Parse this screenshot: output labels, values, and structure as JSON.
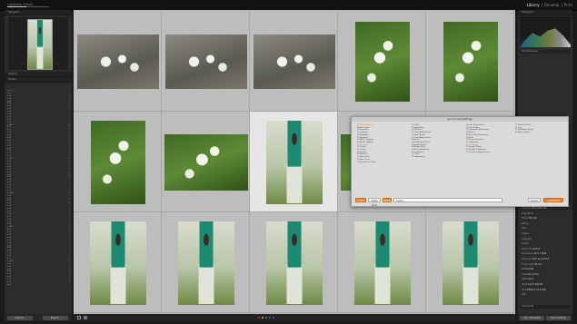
{
  "app": {
    "identity": "Lightroom Classic",
    "progress_fraction": 0.45,
    "modules": [
      "Library",
      "Develop",
      "Print"
    ],
    "active_module": "Library",
    "accent": "#e9842c"
  },
  "left_panel": {
    "navigator_label": "Navigator",
    "catalog_label": "Catalog",
    "folders_label": "Folders",
    "folders": [
      {
        "label": "▾ 2015",
        "count": "51"
      },
      {
        "label": "  ▸ 01",
        "count": "2"
      },
      {
        "label": "  ▸ 02",
        "count": "8"
      },
      {
        "label": "  ▸ 03",
        "count": "4"
      },
      {
        "label": "  ▸ 04",
        "count": "6"
      },
      {
        "label": "  ▸ 05",
        "count": "3"
      },
      {
        "label": "  ▸ 06",
        "count": "12"
      },
      {
        "label": "  ▸ 07",
        "count": "9"
      },
      {
        "label": "  ▸ 08",
        "count": "1"
      },
      {
        "label": "  ▸ 09",
        "count": "5"
      },
      {
        "label": "  ▸ 10",
        "count": "7"
      },
      {
        "label": "  ▸ 11",
        "count": "2"
      },
      {
        "label": "  ▸ 12",
        "count": "3"
      },
      {
        "label": "▾ 2016",
        "count": "88"
      },
      {
        "label": "  ▸ 01",
        "count": "4"
      },
      {
        "label": "  ▸ 02",
        "count": "10"
      },
      {
        "label": "  ▸ 03",
        "count": "6"
      },
      {
        "label": "  ▸ 04",
        "count": "14"
      },
      {
        "label": "  ▸ 05",
        "count": "9"
      },
      {
        "label": "  ▸ 06",
        "count": "11"
      },
      {
        "label": "  ▸ 07",
        "count": "5"
      },
      {
        "label": "  ▸ 08",
        "count": "8"
      },
      {
        "label": "  ▸ 09",
        "count": "3"
      },
      {
        "label": "  ▸ 10",
        "count": "7"
      },
      {
        "label": "  ▸ 11",
        "count": "6"
      },
      {
        "label": "  ▸ 12",
        "count": "5"
      },
      {
        "label": "▾ 2017",
        "count": "120"
      },
      {
        "label": "  ▸ 01",
        "count": "9"
      },
      {
        "label": "  ▸ 02",
        "count": "11"
      },
      {
        "label": "  ▸ 03",
        "count": "15"
      },
      {
        "label": "  ▸ 04",
        "count": "12"
      },
      {
        "label": "  ▸ 05",
        "count": "20"
      },
      {
        "label": "  ▸ 06",
        "count": "8"
      },
      {
        "label": "  ▸ 07",
        "count": "10"
      },
      {
        "label": "  ▸ 08",
        "count": "6"
      },
      {
        "label": "  ▸ 09",
        "count": "7"
      },
      {
        "label": "  ▸ 10",
        "count": "9"
      },
      {
        "label": "  ▸ 11",
        "count": "5"
      },
      {
        "label": "  ▸ 12",
        "count": "8"
      },
      {
        "label": "▾ 2018",
        "count": "64"
      },
      {
        "label": "  ▸ 01",
        "count": "3"
      },
      {
        "label": "  ▸ 02",
        "count": "6"
      },
      {
        "label": "  ▸ 03",
        "count": "9"
      },
      {
        "label": "  ▸ 04",
        "count": "14"
      },
      {
        "label": "  ▸ 05",
        "count": "8"
      },
      {
        "label": "  ▸ 06",
        "count": "7"
      },
      {
        "label": "  ▸ 07",
        "count": "5"
      },
      {
        "label": "  ▸ 08",
        "count": "4"
      },
      {
        "label": "  ▸ 09",
        "count": "3"
      },
      {
        "label": "  ▸ 10",
        "count": "2"
      },
      {
        "label": "  ▸ 11",
        "count": "2"
      },
      {
        "label": "  ▸ 12",
        "count": "1"
      },
      {
        "label": "▾ 2019",
        "count": "40"
      },
      {
        "label": "  ▸ 01",
        "count": "3"
      },
      {
        "label": "  ▸ 02",
        "count": "5"
      },
      {
        "label": "  ▸ 03",
        "count": "6"
      },
      {
        "label": "  ▸ 04",
        "count": "4"
      },
      {
        "label": "  ▸ 05",
        "count": "7"
      },
      {
        "label": "  ▸ 06",
        "count": "5"
      },
      {
        "label": "  ▸ 07",
        "count": "3"
      },
      {
        "label": "  ▸ 08",
        "count": "2"
      },
      {
        "label": "  ▸ 09",
        "count": "2"
      },
      {
        "label": "  ▸ 10",
        "count": "1"
      },
      {
        "label": "  ▸ 11",
        "count": "1"
      },
      {
        "label": "  ▸ 12",
        "count": "1"
      },
      {
        "label": "▾ 2020",
        "count": "22"
      },
      {
        "label": "  ▸ 01",
        "count": "2"
      },
      {
        "label": "  ▸ 02",
        "count": "4"
      },
      {
        "label": "  ▸ 03",
        "count": "3"
      },
      {
        "label": "  ▸ 04",
        "count": "5"
      },
      {
        "label": "  ▸ 05",
        "count": "8"
      },
      {
        "label": "  ▸ 06",
        "count": "6"
      },
      {
        "label": "  ▸ 07",
        "count": "4"
      },
      {
        "label": "  ▸ 08",
        "count": "2"
      },
      {
        "label": "  ▸ 09",
        "count": "1"
      }
    ],
    "import_button": "Import...",
    "export_button": "Export..."
  },
  "grid": {
    "rows": [
      [
        {
          "type": "blossom",
          "sel": false
        },
        {
          "type": "blossom",
          "sel": false
        },
        {
          "type": "blossom",
          "sel": false
        },
        {
          "type": "green",
          "sel": false
        },
        {
          "type": "green",
          "sel": false
        }
      ],
      [
        {
          "type": "green",
          "sel": false
        },
        {
          "type": "green",
          "sel": false
        },
        {
          "type": "lady",
          "sel": true
        },
        {
          "type": "green",
          "sel": false
        },
        {
          "type": "green",
          "sel": false
        }
      ],
      [
        {
          "type": "lady",
          "sel": false
        },
        {
          "type": "lady",
          "sel": false
        },
        {
          "type": "lady",
          "sel": false
        },
        {
          "type": "lady",
          "sel": false
        },
        {
          "type": "lady",
          "sel": false
        }
      ]
    ]
  },
  "dialog": {
    "title": "Synchronize Settings",
    "columns": [
      [
        {
          "t": "☑ White Balance",
          "o": true
        },
        {
          "t": "☑ Basic Tone"
        },
        {
          "t": "  ☑ Exposure"
        },
        {
          "t": "  ☑ Contrast"
        },
        {
          "t": "  ☑ Highlights"
        },
        {
          "t": "  ☑ Shadows"
        },
        {
          "t": "  ☑ White Clipping"
        },
        {
          "t": "  ☑ Black Clipping"
        },
        {
          "t": "☑ Presence",
          "o": true
        },
        {
          "t": "  ☑ Texture"
        },
        {
          "t": "  ☑ Clarity"
        },
        {
          "t": "  ☑ Dehaze"
        },
        {
          "t": "  ☑ Vibrance"
        },
        {
          "t": "  ☑ Saturation"
        },
        {
          "t": "☑ Tone Curve"
        },
        {
          "t": "☑ Treatment (Color)"
        }
      ],
      [
        {
          "t": "☑ Color"
        },
        {
          "t": "☑ Saturation"
        },
        {
          "t": "☑ Vibrance"
        },
        {
          "t": "☑ Color Adjustments"
        },
        {
          "t": "☑ Split Toning"
        },
        {
          "t": "☑ Local Adjustments"
        },
        {
          "t": "  ☑ Brush"
        },
        {
          "t": "  ☑ Graduated Filters"
        },
        {
          "t": "  ☑ Radial Filters"
        },
        {
          "t": "  ☑ Range Mask"
        },
        {
          "t": "☑ Noise Reduction"
        },
        {
          "t": "  ☑ Luminance"
        },
        {
          "t": "  ☑ Color"
        },
        {
          "t": "☑ Sharpening"
        }
      ],
      [
        {
          "t": "☑ Lens Corrections"
        },
        {
          "t": "  ☑ Lens Profile"
        },
        {
          "t": "  ☑ Chromatic Aberration"
        },
        {
          "t": "☑ Effects"
        },
        {
          "t": "  ☑ Post-Crop Vignetting"
        },
        {
          "t": "  ☑ Grain"
        },
        {
          "t": "☑ Process Version"
        },
        {
          "t": "☑ Calibration"
        },
        {
          "t": "☑ Transform",
          "o": true
        },
        {
          "t": "  ☑ Upright Mode"
        },
        {
          "t": "  ☑ Upright Transforms"
        },
        {
          "t": "  ☑ Transform Adjustments"
        }
      ],
      [
        {
          "t": "☑ Spot Removal"
        },
        {
          "t": "☑ Crop"
        },
        {
          "t": "  ☑ Straighten Angle"
        },
        {
          "t": "  ☑ Aspect Ratio"
        }
      ]
    ],
    "check_all": "Check All",
    "check_none": "Check None",
    "preset_label": "Default",
    "preset_placeholder": "Custom",
    "cancel": "Cancel",
    "synchronize": "Synchronize"
  },
  "right_panel": {
    "histogram_label": "Histogram",
    "quick_develop_label": "Quick Develop",
    "keywording_label": "Keywording",
    "keyword_list_label": "Keyword List",
    "metadata_label": "Metadata",
    "comments_label": "Comments",
    "sync_button": "Sync Settings",
    "sync_meta_button": "Sync Metadata",
    "meta_rows": [
      {
        "k": "File Name",
        "v": "IMG_2041.CR2"
      },
      {
        "k": "Copy Name",
        "v": ""
      },
      {
        "k": "Folder",
        "v": "2017-04"
      },
      {
        "k": "Rating",
        "v": "· · · · ·"
      },
      {
        "k": "Title",
        "v": ""
      },
      {
        "k": "Caption",
        "v": ""
      },
      {
        "k": "Copyright",
        "v": ""
      },
      {
        "k": "Creator",
        "v": ""
      },
      {
        "k": "Date Time",
        "v": "4/23/17"
      },
      {
        "k": "Dimensions",
        "v": "5472 x 3648"
      },
      {
        "k": "Exposure",
        "v": "1/400 sec at f/2.8"
      },
      {
        "k": "Focal Length",
        "v": "85 mm"
      },
      {
        "k": "ISO",
        "v": "ISO 200"
      },
      {
        "k": "Flash",
        "v": "Did not fire"
      },
      {
        "k": "Make",
        "v": "Canon"
      },
      {
        "k": "Model",
        "v": "Canon EOS 6D"
      },
      {
        "k": "Lens",
        "v": "EF85mm f/1.8 USM"
      },
      {
        "k": "GPS",
        "v": ""
      }
    ]
  },
  "filmstrip": {
    "label_colors": [
      "#c23b3b",
      "#d9c234",
      "#3fa33f",
      "#3b6fc2",
      "#8f3fc2"
    ]
  }
}
